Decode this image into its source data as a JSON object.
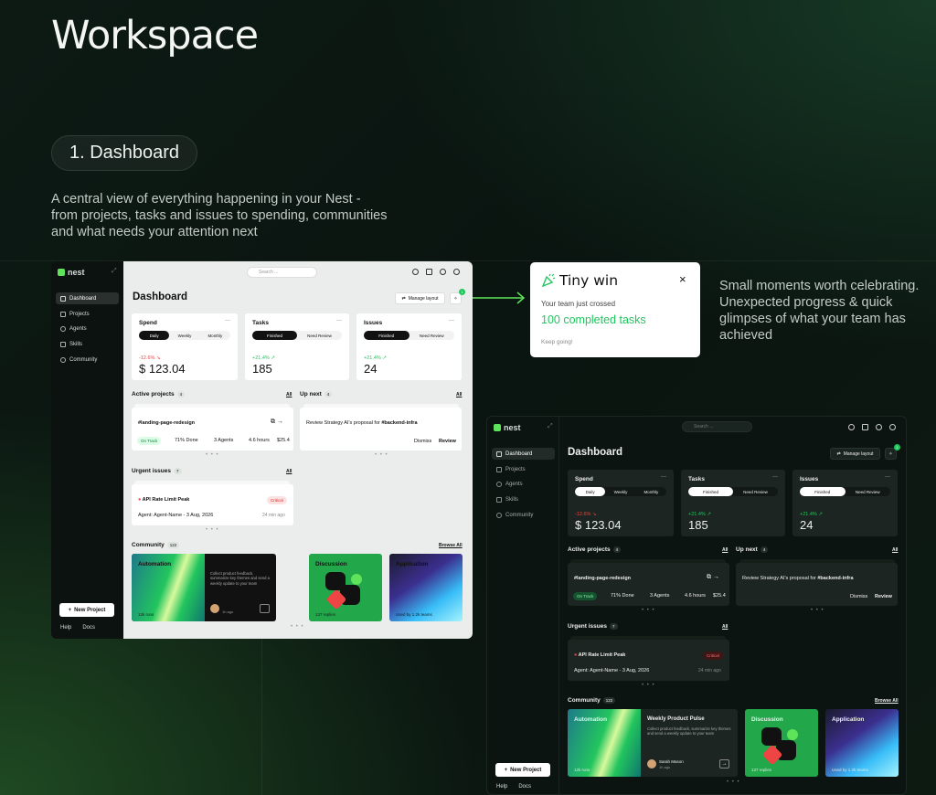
{
  "heading": "Workspace",
  "section_pill": "1. Dashboard",
  "description": "A central view of everything happening in your Nest - from projects, tasks and issues to spending, communities and what needs your attention next",
  "side_note": "Small moments worth celebrating. Unexpected progress & quick glimpses of what your team has achieved",
  "tiny_win": {
    "title": "Tiny win",
    "close": "×",
    "line1": "Your team just crossed",
    "highlight": "100 completed tasks",
    "footer": "Keep going!"
  },
  "dashboard": {
    "logo": "nest",
    "nav": [
      "Dashboard",
      "Projects",
      "Agents",
      "Skills",
      "Community"
    ],
    "new_project": "New Project",
    "help": "Help",
    "docs": "Docs",
    "search_placeholder": "Search ...",
    "page_title": "Dashboard",
    "manage_layout": "Manage layout",
    "notif_count": "1",
    "cards": [
      {
        "label": "Spend",
        "tabs": [
          "Daily",
          "Weekly",
          "Monthly"
        ],
        "delta": "-12.6% ↘",
        "value": "$ 123.04"
      },
      {
        "label": "Tasks",
        "tabs": [
          "Finished",
          "Need Review"
        ],
        "delta": "+21.4% ↗",
        "value": "185"
      },
      {
        "label": "Issues",
        "tabs": [
          "Finished",
          "Need Review"
        ],
        "delta": "+21.4% ↗",
        "value": "24"
      }
    ],
    "active_projects": {
      "title": "Active projects",
      "count": "4",
      "all": "All",
      "name": "#landing-page-redesign",
      "status": "On Track",
      "done": "71% Done",
      "agents": "3 Agents",
      "hours": "4.6 hours",
      "cost": "$25.4"
    },
    "up_next": {
      "title": "Up next",
      "count": "4",
      "all": "All",
      "text_prefix": "Review Strategy AI's proposal for",
      "text_tag": "#backend-infra",
      "dismiss": "Dismiss",
      "review": "Review"
    },
    "urgent": {
      "title": "Urgent issues",
      "count": "7",
      "all": "All",
      "name": "API Rate Limit Peak",
      "level": "Critical",
      "agent": "Agent: Agent-Name - 3 Aug, 2026",
      "ago": "24 min ago"
    },
    "community": {
      "title": "Community",
      "count": "122",
      "browse": "Browse All",
      "automation": {
        "title": "Automation",
        "meta": "12k runs",
        "post_title": "Weekly Product Pulse",
        "post_body": "Collect product feedback, summarize key themes and send a weekly update to your team",
        "author": "Sarah Mason",
        "author_meta": "1h ago"
      },
      "discussion": {
        "title": "Discussion",
        "meta": "137 replies"
      },
      "application": {
        "title": "Application",
        "meta": "Used by 1.2k teams"
      }
    }
  },
  "colors": {
    "accent": "#22c55e",
    "accent_dark": "#16a34a",
    "negative": "#ef4444",
    "bg_dark": "#0b1512"
  }
}
